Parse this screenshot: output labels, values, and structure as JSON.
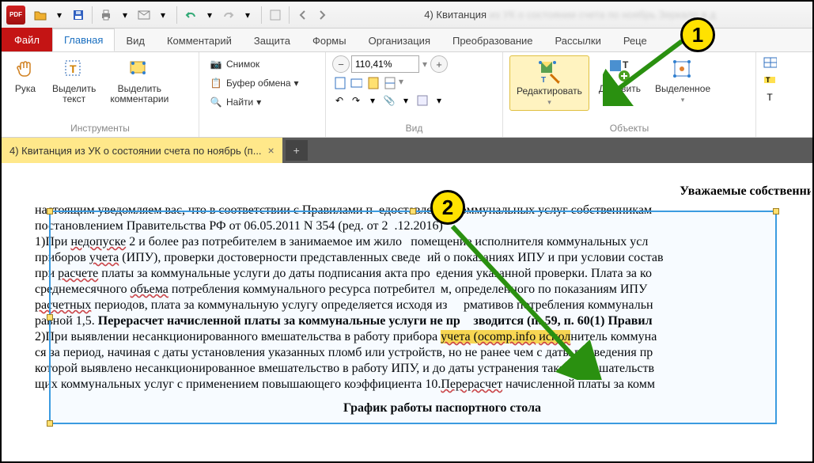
{
  "title_prefix": "4) Квитанция",
  "tabs": {
    "file": "Файл",
    "main": "Главная",
    "view": "Вид",
    "comment": "Комментарий",
    "protect": "Защита",
    "forms": "Формы",
    "organize": "Организация",
    "convert": "Преобразование",
    "mail": "Рассылки",
    "rece": "Реце"
  },
  "ribbon": {
    "hand": "Рука",
    "select_text": "Выделить\nтекст",
    "select_comments": "Выделить\nкомментарии",
    "snapshot": "Снимок",
    "clipboard": "Буфер обмена",
    "find": "Найти",
    "group_tools": "Инструменты",
    "zoom_value": "110,41%",
    "group_view": "Вид",
    "edit": "Редактировать",
    "add": "Добавить",
    "selected": "Выделенное",
    "group_objects": "Объекты"
  },
  "doctab": {
    "name": "4) Квитанция из УК о состоянии счета по ноябрь (п..."
  },
  "page": {
    "hdr": "Уважаемые собственники (на",
    "l1a": "настоящим уведомляем вас, что в соответствии с Правилами ",
    "l1b": "едоставления коммунальных услуг собственникам",
    "l2": "постановлением Правительства РФ от 06.05.2011 N 354 (ред. от 2",
    "l2b": ".12.2016)",
    "l3a": "1)При ",
    "l3u": "недопуске",
    "l3b": " 2 и более раз потребителем в занимаемое им жило",
    "l3c": " помещение исполнителя коммунальных усл",
    "l4a": "приборов ",
    "l4u": "учета",
    "l4b": " (ИПУ), проверки достоверности представленных сведе",
    "l4c": "ий о показаниях ИПУ и при условии состав",
    "l5a": "при ",
    "l5u": "расчете",
    "l5b": " платы за коммунальные услуги до даты подписания акта про",
    "l5c": "едения указанной проверки. Плата за ко",
    "l6a": "среднемесячного ",
    "l6u": "объема",
    "l6b": " потребления коммунального ресурса потребител",
    "l6c": "м, определенного по показаниям ИПУ ",
    "l7a": "расчетных",
    "l7b": " периодов, плата за коммунальную услугу определяется исходя из ",
    "l7c": "рмативов потребления коммунальн",
    "l8a": "равной 1,5. ",
    "l8b": "Перерасчет начисленной платы за коммунальные услуги не пр",
    "l8c": "зводится (п. 59, п. 60(1) Правил",
    "l9a": "2)При выявлении несанкционированного вмешательства в работу прибора ",
    "l9h1": "учета",
    "l9m": " (",
    "l9h2": "ocomp.info",
    "l9n": " ",
    "l9h3": "испол",
    "l9b": "нитель коммуна",
    "l10": "ся за период, начиная с даты установления указанных пломб или устройств, но не ранее чем с даты проведения пр",
    "l11": "которой выявлено несанкционированное вмешательство в работу ИПУ, и до даты устранения такого вмешательств",
    "l12a": "щих коммунальных услуг с применением повышающего коэффициента 10.",
    "l12u": "Перерасчет",
    "l12b": " начисленной платы за комм",
    "ftr": "График работы паспортного стола"
  },
  "badges": {
    "b1": "1",
    "b2": "2"
  }
}
